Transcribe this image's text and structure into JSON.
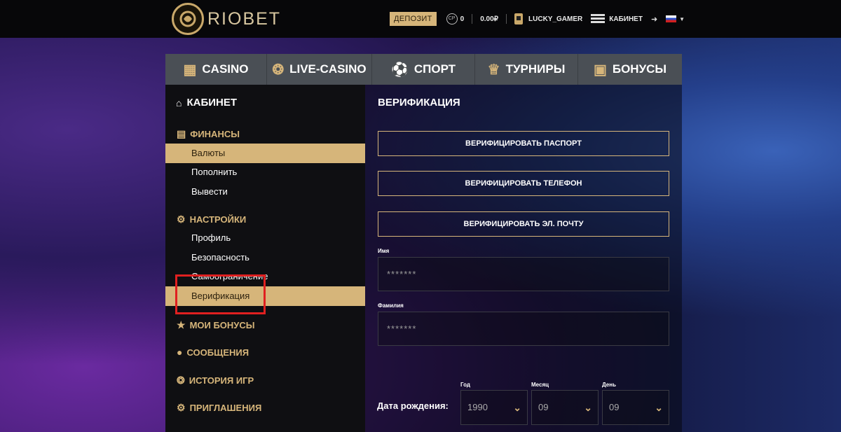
{
  "header": {
    "brand": "RIOBET",
    "deposit_label": "ДЕПОЗИТ",
    "cp_label": "CP",
    "cp_value": "0",
    "balance": "0.00₽",
    "username": "LUCKY_GAMER",
    "cabinet_label": "КАБИНЕТ"
  },
  "nav": {
    "items": [
      {
        "label": "CASINO",
        "icon": "slot-machine-icon"
      },
      {
        "label": "LIVE-CASINO",
        "icon": "chips-icon"
      },
      {
        "label": "СПОРТ",
        "icon": "soccer-ball-icon"
      },
      {
        "label": "ТУРНИРЫ",
        "icon": "trophy-icon"
      },
      {
        "label": "БОНУСЫ",
        "icon": "gift-icon"
      }
    ]
  },
  "sidebar": {
    "title": "КАБИНЕТ",
    "finance": {
      "label": "ФИНАНСЫ",
      "items": [
        "Валюты",
        "Пополнить",
        "Вывести"
      ]
    },
    "settings": {
      "label": "НАСТРОЙКИ",
      "items": [
        "Профиль",
        "Безопасность",
        "Самоограничение",
        "Верификация"
      ]
    },
    "bonuses": "МОИ БОНУСЫ",
    "messages": "СООБЩЕНИЯ",
    "history": "ИСТОРИЯ ИГР",
    "invites": "ПРИГЛАШЕНИЯ"
  },
  "content": {
    "title": "ВЕРИФИКАЦИЯ",
    "verify_passport": "ВЕРИФИЦИРОВАТЬ ПАСПОРТ",
    "verify_phone": "ВЕРИФИЦИРОВАТЬ ТЕЛЕФОН",
    "verify_email": "ВЕРИФИЦИРОВАТЬ ЭЛ. ПОЧТУ",
    "first_name_label": "Имя",
    "first_name_value": "*******",
    "last_name_label": "Фамилия",
    "last_name_value": "*******",
    "dob_label": "Дата рождения:",
    "year_label": "Год",
    "year_value": "1990",
    "month_label": "Месяц",
    "month_value": "09",
    "day_label": "День",
    "day_value": "09"
  },
  "colors": {
    "accent": "#d6b57a",
    "highlight_box": "#e02020"
  }
}
